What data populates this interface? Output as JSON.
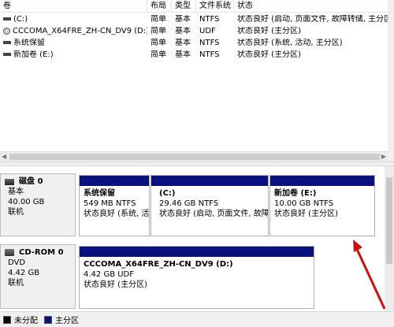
{
  "columns": {
    "volume": "卷",
    "layout": "布局",
    "type": "类型",
    "filesystem": "文件系统",
    "status": "状态"
  },
  "volumes": [
    {
      "name": "(C:)",
      "icon": "volume-icon",
      "layout": "简单",
      "type": "基本",
      "fs": "NTFS",
      "status": "状态良好 (启动, 页面文件, 故障转储, 主分区"
    },
    {
      "name": "CCCOMA_X64FRE_ZH-CN_DV9 (D:)",
      "icon": "cd-icon",
      "layout": "简单",
      "type": "基本",
      "fs": "UDF",
      "status": "状态良好 (主分区)"
    },
    {
      "name": "系统保留",
      "icon": "volume-icon",
      "layout": "简单",
      "type": "基本",
      "fs": "NTFS",
      "status": "状态良好 (系统, 活动, 主分区)"
    },
    {
      "name": "新加卷 (E:)",
      "icon": "volume-icon",
      "layout": "简单",
      "type": "基本",
      "fs": "NTFS",
      "status": "状态良好 (主分区)"
    }
  ],
  "disks": [
    {
      "title": "磁盘 0",
      "kind": "基本",
      "size": "40.00 GB",
      "state": "联机",
      "partitions": [
        {
          "name": "系统保留",
          "size": "549 MB NTFS",
          "status": "状态良好 (系统, 活"
        },
        {
          "name": "(C:)",
          "size": "29.46 GB NTFS",
          "status": "状态良好 (启动, 页面文件, 故障"
        },
        {
          "name": "新加卷  (E:)",
          "size": "10.00 GB NTFS",
          "status": "状态良好 (主分区)"
        }
      ]
    },
    {
      "title": "CD-ROM 0",
      "kind": "DVD",
      "size": "4.42 GB",
      "state": "联机",
      "partitions": [
        {
          "name": "CCCOMA_X64FRE_ZH-CN_DV9  (D:)",
          "size": "4.42 GB UDF",
          "status": "状态良好 (主分区)"
        }
      ]
    }
  ],
  "legend": {
    "unallocated": "未分配",
    "primary": "主分区"
  },
  "colors": {
    "partition_band": "#07127f",
    "unallocated_swatch": "#000000",
    "primary_swatch": "#07127f",
    "annotation_arrow": "#cc1010"
  }
}
